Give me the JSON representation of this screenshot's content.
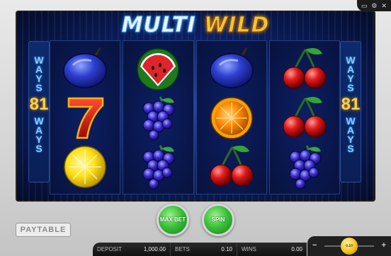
{
  "title": {
    "part1": "MULTI",
    "part2": "WILD"
  },
  "ways": {
    "word": "WAYS",
    "number": "81"
  },
  "reels": [
    [
      "plum",
      "seven",
      "lemon"
    ],
    [
      "watermelon",
      "grapes",
      "grapes"
    ],
    [
      "plum",
      "orange",
      "cherries"
    ],
    [
      "cherries",
      "cherries",
      "grapes"
    ]
  ],
  "buttons": {
    "paytable": "PAYTABLE",
    "max_bet": "MAX BET",
    "spin": "SPIN"
  },
  "status": {
    "deposit_label": "DEPOSIT",
    "deposit_value": "1,000.00",
    "bets_label": "BETS",
    "bets_value": "0.10",
    "wins_label": "WINS",
    "wins_value": "0.00"
  },
  "bet_slider": {
    "minus": "−",
    "plus": "+",
    "knob_label": "0.10",
    "level": 0.5
  },
  "icons": {
    "top": [
      "window-icon",
      "gear-icon",
      "close-icon"
    ]
  },
  "colors": {
    "background": "#d4d4d4",
    "frame": "#0a1d5c",
    "accent_green": "#3bc23a",
    "gold": "#f2c33a"
  }
}
